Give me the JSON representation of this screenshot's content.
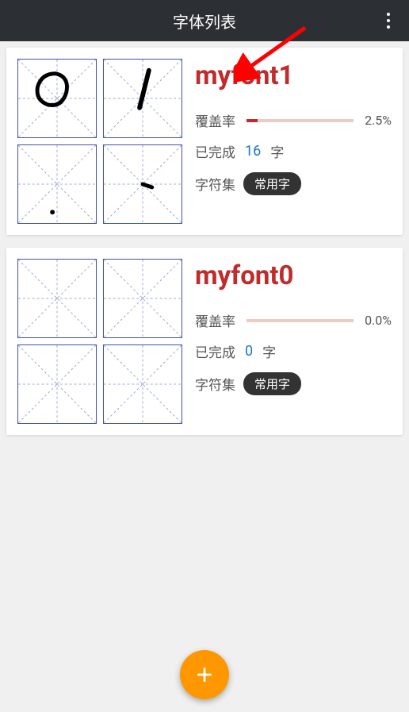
{
  "header": {
    "title": "字体列表"
  },
  "labels": {
    "coverage": "覆盖率",
    "completed": "已完成",
    "charUnit": "字",
    "charset": "字符集"
  },
  "fonts": [
    {
      "name": "myfont1",
      "coverage_pct": "2.5%",
      "coverage_fill": 10,
      "completed_count": "16",
      "charset_badge": "常用字",
      "glyphs": [
        "circle",
        "slash",
        "dot-low",
        "small-dot"
      ]
    },
    {
      "name": "myfont0",
      "coverage_pct": "0.0%",
      "coverage_fill": 0,
      "completed_count": "0",
      "charset_badge": "常用字",
      "glyphs": [
        "empty",
        "empty",
        "empty",
        "empty"
      ]
    }
  ]
}
